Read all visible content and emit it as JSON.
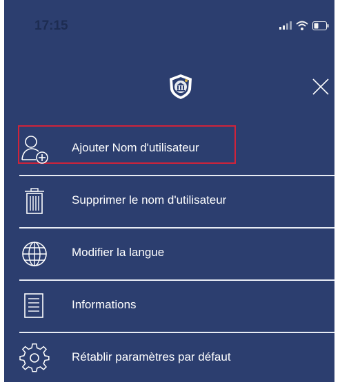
{
  "status_bar": {
    "time": "17:15",
    "icons": [
      "signal-icon",
      "wifi-icon",
      "battery-icon"
    ]
  },
  "header": {
    "logo_icon": "bank-shield-logo",
    "close_icon": "close-icon"
  },
  "menu": {
    "items": [
      {
        "label": "Ajouter Nom d'utilisateur",
        "icon": "add-user-icon",
        "highlighted": true
      },
      {
        "label": "Supprimer le nom d'utilisateur",
        "icon": "trash-icon",
        "highlighted": false
      },
      {
        "label": "Modifier la langue",
        "icon": "globe-icon",
        "highlighted": false
      },
      {
        "label": "Informations",
        "icon": "list-icon",
        "highlighted": false
      },
      {
        "label": "Rétablir paramètres par défaut",
        "icon": "gear-icon",
        "highlighted": false
      }
    ]
  },
  "colors": {
    "background": "#2c3e6f",
    "text": "#ffffff",
    "highlight_border": "#d0233a",
    "divider": "#e8ecf4"
  }
}
